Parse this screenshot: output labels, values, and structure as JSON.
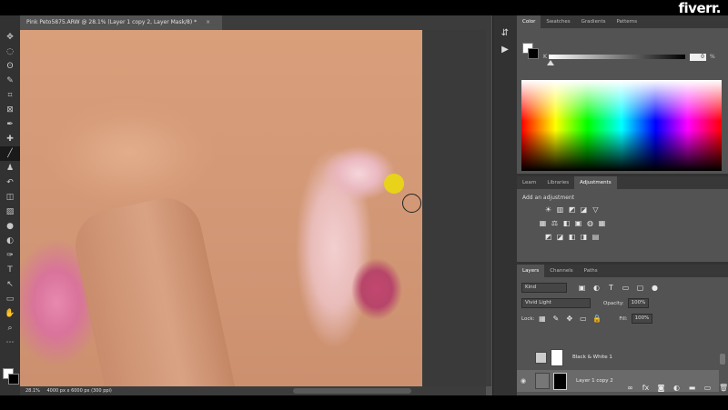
{
  "brand": {
    "logo_text": "fiverr."
  },
  "document": {
    "tab_title": "Pink Peto5875.ARW @ 28.1% (Layer 1 copy 2, Layer Mask/8) *",
    "close_glyph": "×",
    "zoom": "28.1%",
    "dimensions": "4000 px x 6000 px (300 ppi)"
  },
  "tools": {
    "icons": [
      "move-icon",
      "marquee-icon",
      "lasso-icon",
      "quick-select-icon",
      "crop-icon",
      "frame-icon",
      "eyedropper-icon",
      "healing-icon",
      "brush-icon",
      "stamp-icon",
      "history-brush-icon",
      "eraser-icon",
      "gradient-icon",
      "blur-icon",
      "dodge-icon",
      "pen-icon",
      "type-icon",
      "path-select-icon",
      "shape-icon",
      "hand-icon",
      "zoom-icon",
      "more-icon"
    ],
    "glyphs": [
      "✥",
      "◌",
      "ʘ",
      "✎",
      "⌗",
      "⊠",
      "✒",
      "✚",
      "╱",
      "♟",
      "↶",
      "◫",
      "▨",
      "●",
      "◐",
      "✑",
      "T",
      "↖",
      "▭",
      "✋",
      "⌕",
      "⋯"
    ]
  },
  "colors": {
    "foreground": "#ffffff",
    "background": "#000000",
    "spot": "#e8d31a"
  },
  "colorPanel": {
    "tabs": [
      "Color",
      "Swatches",
      "Gradients",
      "Patterns"
    ],
    "channel_label": "K",
    "value": "0",
    "unit": "%"
  },
  "adjustmentsPanel": {
    "tabs": [
      "Learn",
      "Libraries",
      "Adjustments"
    ],
    "hint": "Add an adjustment",
    "row1": [
      "☀",
      "▥",
      "◩",
      "◪",
      "▽"
    ],
    "row2": [
      "▦",
      "⚖",
      "◧",
      "▣",
      "◍",
      "▦"
    ],
    "row3": [
      "◩",
      "◪",
      "◧",
      "◨",
      "▤"
    ]
  },
  "layersPanel": {
    "tabs": [
      "Layers",
      "Channels",
      "Paths"
    ],
    "filter_kind": "Kind",
    "blend_mode": "Vivid Light",
    "opacity_label": "Opacity:",
    "opacity_value": "100%",
    "lock_label": "Lock:",
    "fill_label": "Fill:",
    "fill_value": "100%",
    "filter_icons": [
      "▣",
      "◐",
      "T",
      "▭",
      "▢",
      "●"
    ],
    "lock_icons": [
      "▦",
      "✎",
      "✥",
      "▭",
      "🔒"
    ],
    "layers": [
      {
        "name": "Black & White 1",
        "visible_glyph": ""
      },
      {
        "name": "Layer 1 copy 2",
        "visible_glyph": "◉"
      }
    ],
    "footer_icons": [
      "∞",
      "fx",
      "◙",
      "◐",
      "▬",
      "▭",
      "🗑"
    ]
  },
  "midColumn": {
    "icons": [
      "⇵",
      "▶"
    ]
  }
}
